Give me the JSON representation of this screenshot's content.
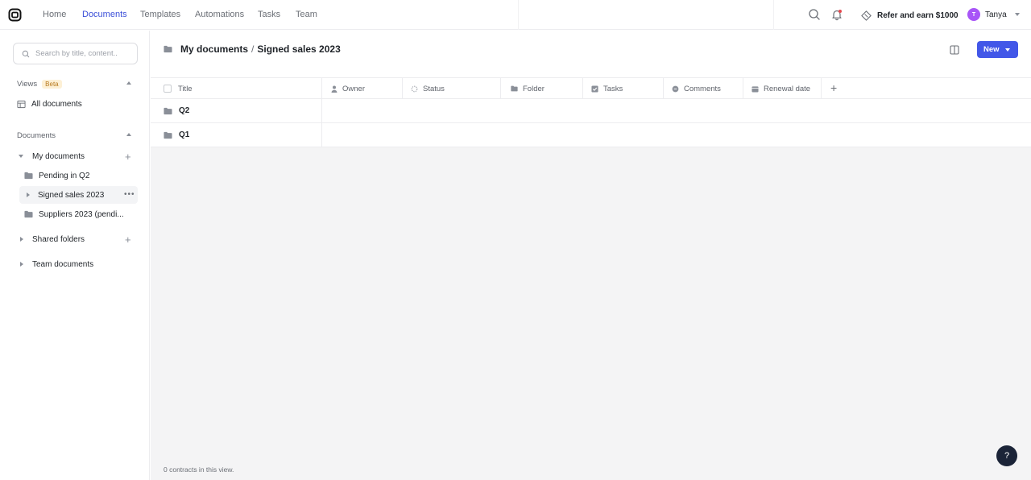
{
  "nav": {
    "items": [
      "Home",
      "Documents",
      "Templates",
      "Automations",
      "Tasks",
      "Team"
    ],
    "active": "Documents",
    "refer_label": "Refer and earn $1000",
    "user_name": "Tanya",
    "user_initial": "T"
  },
  "sidebar": {
    "search_placeholder": "Search by title, content..",
    "views_title": "Views",
    "views_badge": "Beta",
    "all_documents": "All documents",
    "documents_title": "Documents",
    "my_documents": "My documents",
    "folders": [
      "Pending in Q2",
      "Signed sales 2023",
      "Suppliers 2023 (pendi..."
    ],
    "selected_folder": "Signed sales 2023",
    "shared_folders": "Shared folders",
    "team_documents": "Team documents"
  },
  "main": {
    "breadcrumb_root": "My documents",
    "breadcrumb_sep": "/",
    "breadcrumb_current": "Signed sales 2023",
    "new_label": "New",
    "columns": [
      "Title",
      "Owner",
      "Status",
      "Folder",
      "Tasks",
      "Comments",
      "Renewal date"
    ],
    "rows": [
      "Q2",
      "Q1"
    ],
    "footer": "0 contracts in this view.",
    "help_label": "?"
  },
  "colors": {
    "accent": "#4257e8",
    "active_nav": "#3b4fd8",
    "avatar": "#a855f7",
    "help_bg": "#1b2438"
  }
}
